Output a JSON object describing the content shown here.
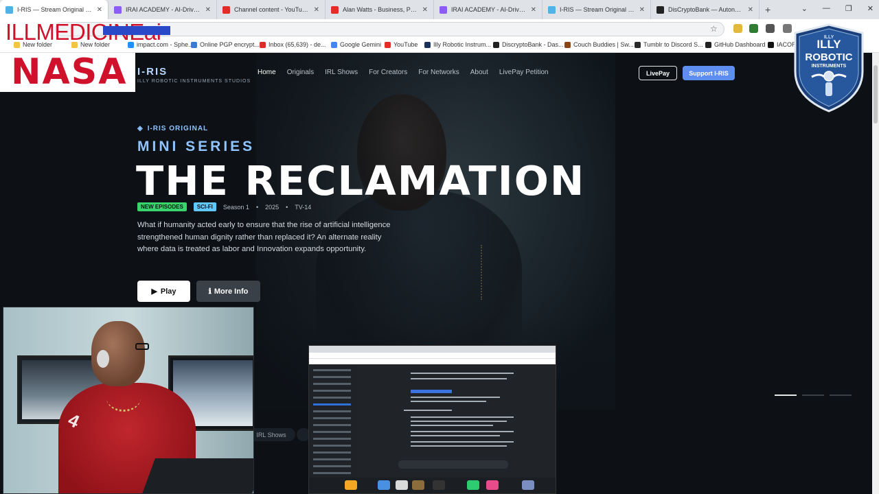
{
  "browser": {
    "tabs": [
      {
        "title": "I-RIS — Stream Original Series",
        "favicon_color": "#4fb3e8",
        "active": true
      },
      {
        "title": "IRAI ACADEMY - AI-Driven Dev",
        "favicon_color": "#8b5cf6",
        "active": false
      },
      {
        "title": "Channel content - YouTube Stu",
        "favicon_color": "#e52d27",
        "active": false
      },
      {
        "title": "Alan Watts - Business, Propaga",
        "favicon_color": "#e52d27",
        "active": false
      },
      {
        "title": "IRAI ACADEMY - AI-Driven Dev",
        "favicon_color": "#8b5cf6",
        "active": false
      },
      {
        "title": "I-RIS — Stream Original Series",
        "favicon_color": "#4fb3e8",
        "active": false
      },
      {
        "title": "DisCryptoBank — Autonomous",
        "favicon_color": "#222222",
        "active": false
      }
    ],
    "new_tab": "+",
    "window_controls": [
      "⌄",
      "—",
      "❐",
      "✕"
    ],
    "bookmarks": [
      {
        "label": "New folder",
        "color": "#f4c542"
      },
      {
        "label": "New folder",
        "color": "#f4c542"
      },
      {
        "label": "impact.com - Sphe...",
        "color": "#1e90ff"
      },
      {
        "label": "Online PGP encrypt...",
        "color": "#3a7bd5"
      },
      {
        "label": "Inbox (65,639) - de...",
        "color": "#d93025"
      },
      {
        "label": "Google Gemini",
        "color": "#4285f4"
      },
      {
        "label": "YouTube",
        "color": "#e52d27"
      },
      {
        "label": "Illy Robotic Instrum...",
        "color": "#1a2f5a"
      },
      {
        "label": "DiscryptoBank - Das...",
        "color": "#222222"
      },
      {
        "label": "Couch Buddies | Sw...",
        "color": "#8b4513"
      },
      {
        "label": "Tumblr to Discord S...",
        "color": "#2a2a2a"
      },
      {
        "label": "GitHub Dashboard",
        "color": "#222222"
      },
      {
        "label": "IACORP",
        "color": "#111111"
      }
    ]
  },
  "overlays": {
    "banner_text": "ILLMEDICINEai",
    "nasa_text": "NASA",
    "logo_lines": [
      "ILLY",
      "ROBOTIC",
      "INSTRUMENTS"
    ],
    "logo_small": "ILLY"
  },
  "site": {
    "brand_name": "I-RIS",
    "brand_sub": "ILLY ROBOTIC INSTRUMENTS STUDIOS",
    "nav": [
      "Home",
      "Originals",
      "IRL Shows",
      "For Creators",
      "For Networks",
      "About",
      "LivePay Petition"
    ],
    "livepay_btn": "LivePay",
    "support_btn": "Support I-RIS",
    "original_label": "I-RIS ORIGINAL",
    "series_label": "MINI SERIES",
    "title": "THE RECLAMATION",
    "badges": {
      "new": "NEW EPISODES",
      "genre": "SCI-FI"
    },
    "meta": {
      "season": "Season 1",
      "year": "2025",
      "rating": "TV-14",
      "sep": "•"
    },
    "description": "What if humanity acted early to ensure that the rise of artificial intelligence strengthened human dignity rather than replaced it? An alternate reality where data is treated as labor and Innovation expands opportunity.",
    "play_btn": "Play",
    "info_btn": "More Info",
    "row_chip": "IRL Shows",
    "carousel_dots": 3,
    "carousel_active": 1
  },
  "icons": {
    "play": "play-icon",
    "info": "info-icon",
    "star": "star-icon",
    "diamond": "diamond-icon"
  },
  "colors": {
    "accent": "#5e8ff0",
    "label_blue": "#8fc4ff",
    "badge_new": "#39d46b",
    "badge_scifi": "#62c6ff",
    "overlay_red": "#d0112b"
  },
  "cam": {
    "jersey_number": "4"
  }
}
